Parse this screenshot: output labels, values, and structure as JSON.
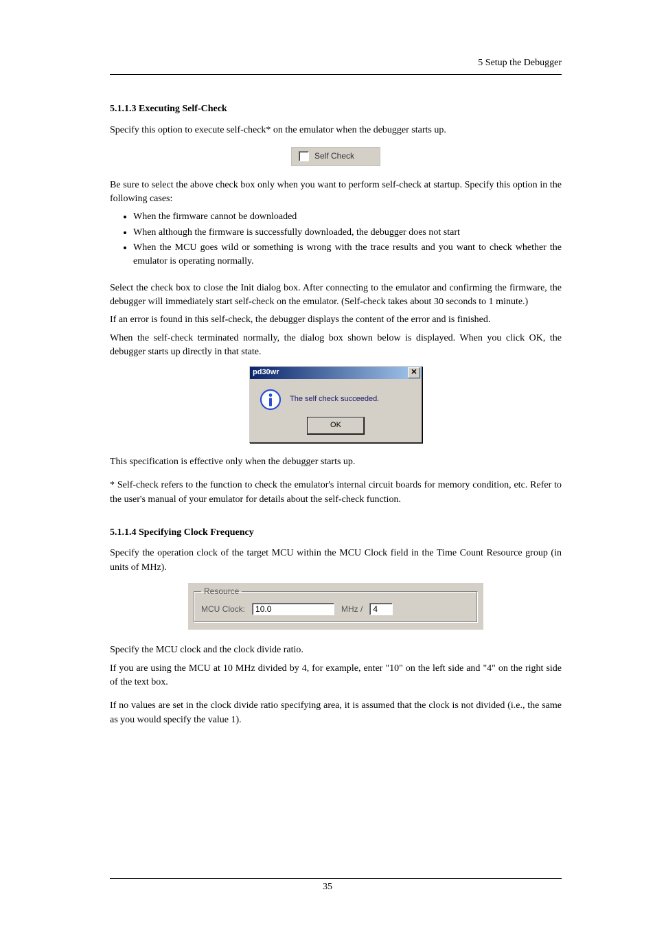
{
  "header": {
    "running_head": "5 Setup the Debugger"
  },
  "sec1": {
    "heading": "5.1.1.3 Executing Self-Check",
    "intro": "Specify this option to execute self-check* on the emulator when the debugger starts up.",
    "checkbox_label": "Self Check",
    "p1": "Be sure to select the above check box only when you want to perform self-check at startup. Specify this option in the following cases:",
    "bullets": [
      "When the firmware cannot be downloaded",
      "When although the firmware is successfully downloaded, the debugger does not start",
      "When the MCU goes wild or something is wrong with the trace results and you want to check whether the emulator is operating normally."
    ],
    "p2": "Select the check box to close the Init dialog box. After connecting to the emulator and confirming the firmware, the debugger will immediately start self-check on the emulator. (Self-check takes about 30 seconds to 1 minute.)",
    "p3": "If an error is found in this self-check, the debugger displays the content of the error and is finished.",
    "p4": "When the self-check terminated normally, the dialog box shown below is displayed. When you click OK, the debugger starts up directly in that state.",
    "dialog": {
      "title": "pd30wr",
      "message": "The self check succeeded.",
      "ok": "OK"
    },
    "p5": "This specification is effective only when the debugger starts up.",
    "p6": "* Self-check refers to the function to check the emulator's internal circuit boards for memory condition, etc. Refer to the user's manual of your emulator for details about the self-check function."
  },
  "sec2": {
    "heading": "5.1.1.4 Specifying Clock Frequency",
    "intro": "Specify the operation clock of the target MCU within the MCU Clock field in the Time Count Resource group (in units of MHz).",
    "group_label": "Resource",
    "field_label": "MCU Clock:",
    "mcu_value": "10.0",
    "unit_label": "MHz /",
    "div_value": "4",
    "p1": "Specify the MCU clock and the clock divide ratio.",
    "p2": "If you are using the MCU at 10 MHz divided by 4, for example, enter \"10\" on the left side and \"4\" on the right side of the text box.",
    "p3": "If no values are set in the clock divide ratio specifying area, it is assumed that the clock is not divided (i.e., the same as you would specify the value 1)."
  },
  "footer": {
    "page_number": "35"
  }
}
